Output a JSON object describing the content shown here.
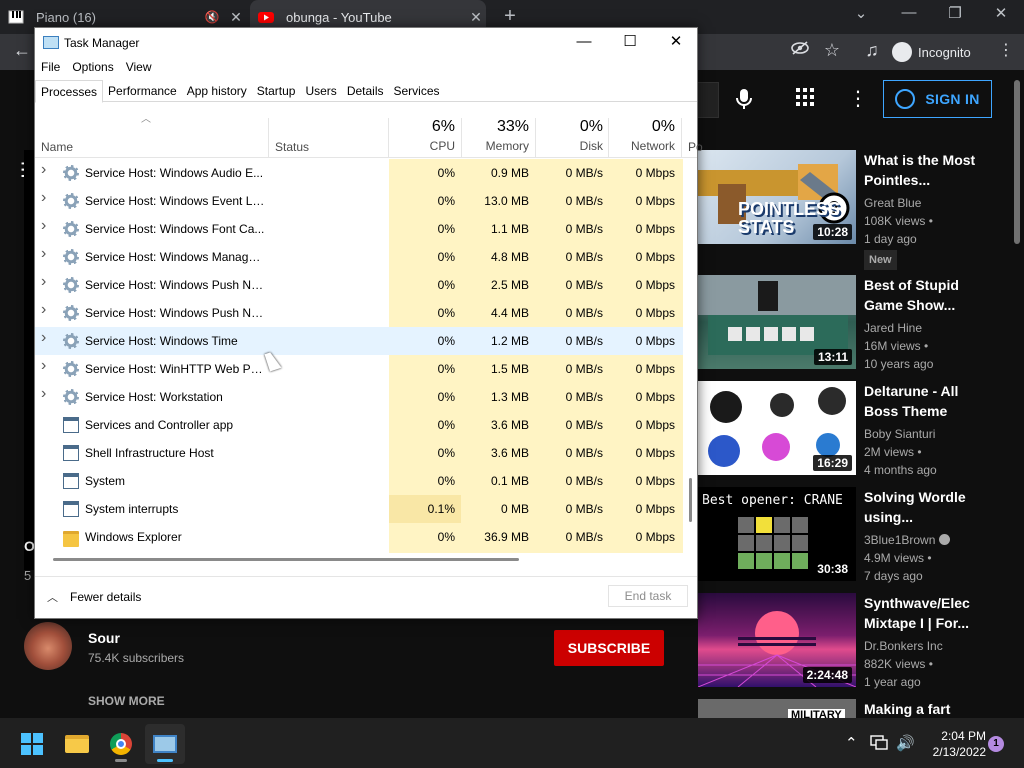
{
  "browser": {
    "tabs": [
      {
        "title": "Piano (16)",
        "muted": true
      },
      {
        "title": "obunga - YouTube",
        "active": true
      }
    ],
    "new_tab": "+",
    "profile_label": "Incognito"
  },
  "youtube": {
    "sign_in": "SIGN IN",
    "left_title_fragment": "O",
    "left_meta_fragment": "5",
    "channel": {
      "name": "Sour",
      "subscribers": "75.4K subscribers"
    },
    "subscribe": "SUBSCRIBE",
    "show_more": "SHOW MORE",
    "recommendations": [
      {
        "title": "What is the Most Pointles...",
        "channel": "Great Blue",
        "views": "108K views",
        "age": "1 day ago",
        "badge": "New",
        "duration": "10:28",
        "thumb_text": "POINTLESS STATS"
      },
      {
        "title": "Best of Stupid Game Show...",
        "channel": "Jared Hine",
        "views": "16M views",
        "age": "10 years ago",
        "duration": "13:11",
        "thumb_text": ""
      },
      {
        "title": "Deltarune - All Boss Theme",
        "channel": "Boby Sianturi",
        "views": "2M views",
        "age": "4 months ago",
        "duration": "16:29",
        "thumb_text": ""
      },
      {
        "title": "Solving Wordle using...",
        "channel": "3Blue1Brown",
        "verified": true,
        "views": "4.9M views",
        "age": "7 days ago",
        "duration": "30:38",
        "thumb_text": "Best opener: CRANE"
      },
      {
        "title": "Synthwave/Elec Mixtape I | For...",
        "channel": "Dr.Bonkers Inc",
        "views": "882K views",
        "age": "1 year ago",
        "duration": "2:24:48",
        "thumb_text": ""
      },
      {
        "title": "Making a fart",
        "channel": "",
        "views": "",
        "age": "",
        "duration": "",
        "thumb_text": "MILITARY"
      }
    ]
  },
  "task_manager": {
    "title": "Task Manager",
    "menu": [
      "File",
      "Options",
      "View"
    ],
    "tabs": [
      "Processes",
      "Performance",
      "App history",
      "Startup",
      "Users",
      "Details",
      "Services"
    ],
    "active_tab": "Processes",
    "columns": {
      "name": "Name",
      "status": "Status",
      "cpu": {
        "pct": "6%",
        "label": "CPU"
      },
      "memory": {
        "pct": "33%",
        "label": "Memory"
      },
      "disk": {
        "pct": "0%",
        "label": "Disk"
      },
      "network": {
        "pct": "0%",
        "label": "Network"
      },
      "power": "Po"
    },
    "rows": [
      {
        "name": "Service Host: Windows Audio E...",
        "cpu": "0%",
        "memory": "0.9 MB",
        "disk": "0 MB/s",
        "network": "0 Mbps",
        "icon": "gear-icon",
        "expandable": true
      },
      {
        "name": "Service Host: Windows Event Log",
        "cpu": "0%",
        "memory": "13.0 MB",
        "disk": "0 MB/s",
        "network": "0 Mbps",
        "icon": "gear-icon",
        "expandable": true
      },
      {
        "name": "Service Host: Windows Font Ca...",
        "cpu": "0%",
        "memory": "1.1 MB",
        "disk": "0 MB/s",
        "network": "0 Mbps",
        "icon": "gear-icon",
        "expandable": true
      },
      {
        "name": "Service Host: Windows Manage...",
        "cpu": "0%",
        "memory": "4.8 MB",
        "disk": "0 MB/s",
        "network": "0 Mbps",
        "icon": "gear-icon",
        "expandable": true
      },
      {
        "name": "Service Host: Windows Push No...",
        "cpu": "0%",
        "memory": "2.5 MB",
        "disk": "0 MB/s",
        "network": "0 Mbps",
        "icon": "gear-icon",
        "expandable": true
      },
      {
        "name": "Service Host: Windows Push No...",
        "cpu": "0%",
        "memory": "4.4 MB",
        "disk": "0 MB/s",
        "network": "0 Mbps",
        "icon": "gear-icon",
        "expandable": true
      },
      {
        "name": "Service Host: Windows Time",
        "cpu": "0%",
        "memory": "1.2 MB",
        "disk": "0 MB/s",
        "network": "0 Mbps",
        "icon": "gear-icon",
        "expandable": true,
        "hover": true
      },
      {
        "name": "Service Host: WinHTTP Web Pro...",
        "cpu": "0%",
        "memory": "1.5 MB",
        "disk": "0 MB/s",
        "network": "0 Mbps",
        "icon": "gear-icon",
        "expandable": true
      },
      {
        "name": "Service Host: Workstation",
        "cpu": "0%",
        "memory": "1.3 MB",
        "disk": "0 MB/s",
        "network": "0 Mbps",
        "icon": "gear-icon",
        "expandable": true
      },
      {
        "name": "Services and Controller app",
        "cpu": "0%",
        "memory": "3.6 MB",
        "disk": "0 MB/s",
        "network": "0 Mbps",
        "icon": "window-app-icon",
        "expandable": false
      },
      {
        "name": "Shell Infrastructure Host",
        "cpu": "0%",
        "memory": "3.6 MB",
        "disk": "0 MB/s",
        "network": "0 Mbps",
        "icon": "window-app-icon",
        "expandable": false
      },
      {
        "name": "System",
        "cpu": "0%",
        "memory": "0.1 MB",
        "disk": "0 MB/s",
        "network": "0 Mbps",
        "icon": "window-app-icon",
        "expandable": false
      },
      {
        "name": "System interrupts",
        "cpu": "0.1%",
        "memory": "0 MB",
        "disk": "0 MB/s",
        "network": "0 Mbps",
        "icon": "window-app-icon",
        "expandable": false,
        "cpu_highlight": true
      },
      {
        "name": "Windows Explorer",
        "cpu": "0%",
        "memory": "36.9 MB",
        "disk": "0 MB/s",
        "network": "0 Mbps",
        "icon": "folder-icon",
        "expandable": false
      }
    ],
    "fewer_details": "Fewer details",
    "end_task": "End task"
  },
  "taskbar": {
    "time": "2:04 PM",
    "date": "2/13/2022",
    "notification_count": "1"
  }
}
